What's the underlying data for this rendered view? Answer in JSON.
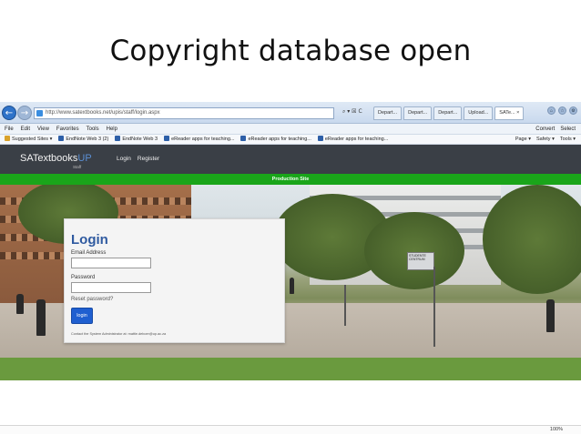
{
  "slide": {
    "title": "Copyright database open"
  },
  "browser": {
    "url": "http://www.satextbooks.net/upis/staff/login.aspx",
    "url_tools": "⌕ ▾ ☒ C",
    "tabs": [
      {
        "label": "Depart..."
      },
      {
        "label": "Depart..."
      },
      {
        "label": "Depart..."
      },
      {
        "label": "Upload..."
      },
      {
        "label": "SATe... ×"
      }
    ],
    "menu": [
      "File",
      "Edit",
      "View",
      "Favorites",
      "Tools",
      "Help"
    ],
    "menu_right": [
      "Convert",
      "Select"
    ],
    "favorites": [
      {
        "label": "Suggested Sites ▾",
        "icon": "star-icon"
      },
      {
        "label": "EndNote Web 3 (2)",
        "icon": "endnote-icon"
      },
      {
        "label": "EndNote Web 3",
        "icon": "endnote-icon"
      },
      {
        "label": "eReader apps for teaching...",
        "icon": "ereader-icon"
      },
      {
        "label": "eReader apps for teaching...",
        "icon": "ereader-icon"
      },
      {
        "label": "eReader apps for teaching...",
        "icon": "ereader-icon"
      }
    ],
    "commands": [
      "Page ▾",
      "Safety ▾",
      "Tools ▾"
    ],
    "zoom": "100%"
  },
  "site": {
    "brand_main": "SATextbooks",
    "brand_accent": "UP",
    "brand_sub": "Staff",
    "nav": [
      "Login",
      "Register"
    ],
    "banner": "Production Site"
  },
  "login": {
    "title": "Login",
    "email_label": "Email Address",
    "email_value": "",
    "password_label": "Password",
    "password_value": "",
    "reset_label": "Reset password?",
    "button_label": "login",
    "contact": "Contact the System Administrator at: mattie.deboer@up.ac.za"
  },
  "photo": {
    "sign_text": "STUDENTE CENTRUM"
  },
  "colors": {
    "header_bg": "#3a3f46",
    "banner_green": "#1aa51a",
    "accent_blue": "#2f5aa0",
    "button_blue": "#1f5fd0"
  }
}
